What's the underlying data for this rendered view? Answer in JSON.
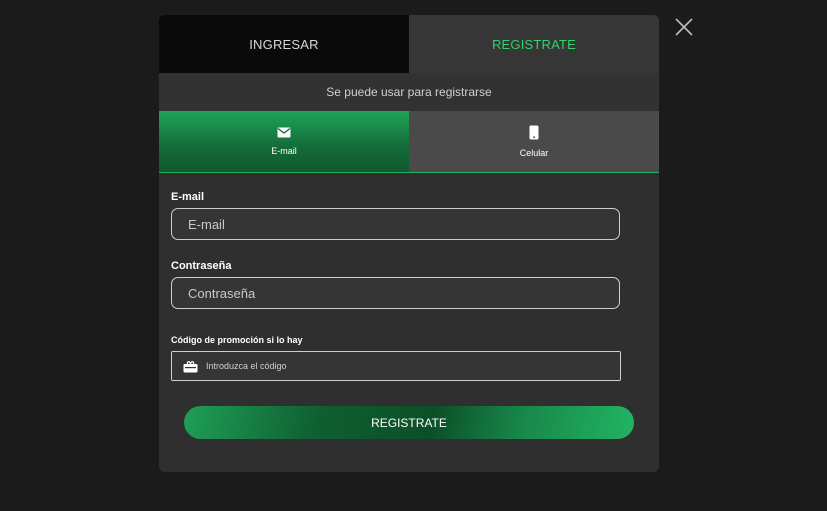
{
  "tabs": {
    "login_label": "INGRESAR",
    "register_label": "REGISTRATE"
  },
  "subtitle": "Se puede usar para registrarse",
  "methods": {
    "email_label": "E-mail",
    "phone_label": "Celular"
  },
  "form": {
    "email_label": "E-mail",
    "email_placeholder": "E-mail",
    "password_label": "Contraseña",
    "password_placeholder": "Contraseña",
    "promo_label": "Código de promoción si lo hay",
    "promo_placeholder": "Introduzca el código"
  },
  "submit_label": "REGISTRATE",
  "colors": {
    "accent": "#2fd36a",
    "background": "#1b1b1b",
    "modal": "#2f2f2f"
  },
  "icons": {
    "close": "close-icon",
    "email": "envelope-icon",
    "phone": "smartphone-icon",
    "promo": "gift-icon"
  }
}
